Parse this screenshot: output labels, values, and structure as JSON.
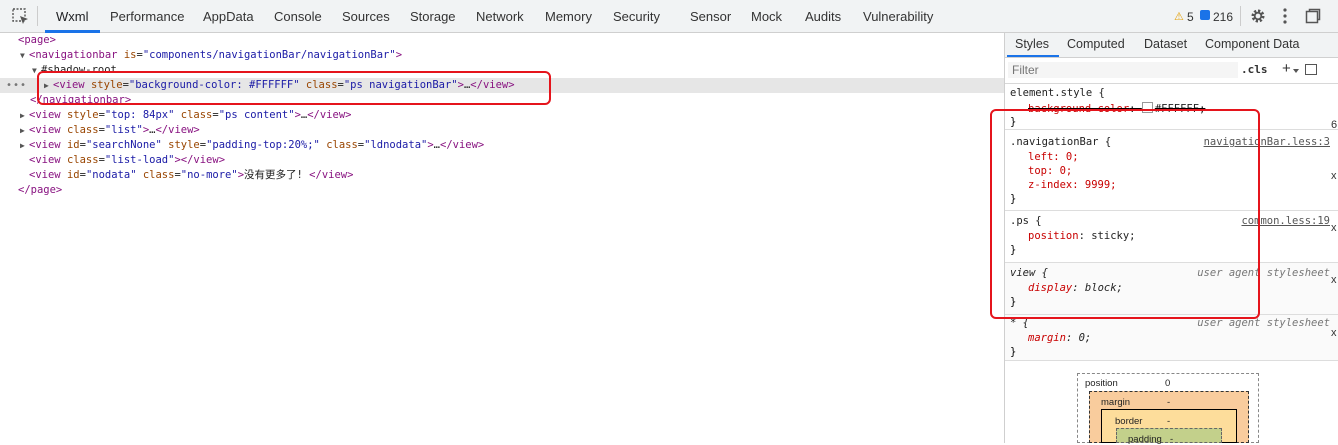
{
  "toolbar": {
    "tabs": [
      "Wxml",
      "Performance",
      "AppData",
      "Console",
      "Sources",
      "Storage",
      "Network",
      "Memory",
      "Security",
      "Sensor",
      "Mock",
      "Audits",
      "Vulnerability"
    ],
    "active_tab": "Wxml",
    "warnings_count": "5",
    "messages_count": "216"
  },
  "tree": {
    "line1": {
      "open": "<",
      "tag": "page",
      "close": ">"
    },
    "line2": {
      "tag": "navigationbar",
      "attr": "is",
      "val": "\"components/navigationBar/navigationBar\""
    },
    "line3": {
      "text": "#shadow-root"
    },
    "line4": {
      "tag": "view",
      "attr1": "style",
      "val1": "\"background-color: #FFFFFF\"",
      "attr2": "class",
      "val2": "\"ps navigationBar\"",
      "ellipsis": "…",
      "end": "</view>"
    },
    "line5": {
      "text": "</navigationbar>"
    },
    "line6": {
      "tag": "view",
      "attr1": "style",
      "val1": "\"top: 84px\"",
      "attr2": "class",
      "val2": "\"ps content\"",
      "ellipsis": "…",
      "end": "</view>"
    },
    "line7": {
      "tag": "view",
      "attr1": "class",
      "val1": "\"list\"",
      "ellipsis": "…",
      "end": "</view>"
    },
    "line8": {
      "tag": "view",
      "attr1": "id",
      "val1": "\"searchNone\"",
      "attr2": "style",
      "val2": "\"padding-top:20%;\"",
      "attr3": "class",
      "val3": "\"ldnodata\"",
      "ellipsis": "…",
      "end": "</view>"
    },
    "line9": {
      "tag": "view",
      "attr1": "class",
      "val1": "\"list-load\"",
      "end": "</view>"
    },
    "line10": {
      "tag": "view",
      "attr1": "id",
      "val1": "\"nodata\"",
      "attr2": "class",
      "val2": "\"no-more\"",
      "content": "没有更多了! ",
      "end": "</view>"
    },
    "line11": {
      "text": "</page>"
    }
  },
  "styles_panel": {
    "tabs": [
      "Styles",
      "Computed",
      "Dataset",
      "Component Data"
    ],
    "filter_placeholder": "Filter",
    "cls_label": ".cls",
    "rules": {
      "element": {
        "selector": "element.style {",
        "prop": "background-color",
        "value": "#FFFFFF;",
        "close": "}"
      },
      "navigationBar": {
        "selector": ".navigationBar {",
        "source": "navigationBar.less:3",
        "props": [
          "left: 0;",
          "top: 0;",
          "z-index: 9999;"
        ],
        "close": "}"
      },
      "ps": {
        "selector": ".ps {",
        "source": "common.less:19",
        "prop": "position",
        "value": "sticky;",
        "close": "}"
      },
      "view": {
        "selector": "view {",
        "source": "user agent stylesheet",
        "prop": "display",
        "value": "block;",
        "close": "}"
      },
      "star": {
        "selector": "* {",
        "source": "user agent stylesheet",
        "prop": "margin",
        "value": "0;",
        "close": "}"
      }
    }
  },
  "box_model": {
    "position_label": "position",
    "position_value": "0",
    "margin_label": "margin",
    "margin_value": "-",
    "border_label": "border",
    "border_value": "-",
    "padding_label": "padding",
    "padding_value": "-"
  },
  "edge": {
    "glyph_a": "6",
    "glyph_b": "x"
  },
  "colors": {
    "accent": "#1a73e8",
    "highlight_box": "#e5141c",
    "tag": "#881280",
    "attr_name": "#994500",
    "attr_value": "#1a1aa6"
  }
}
